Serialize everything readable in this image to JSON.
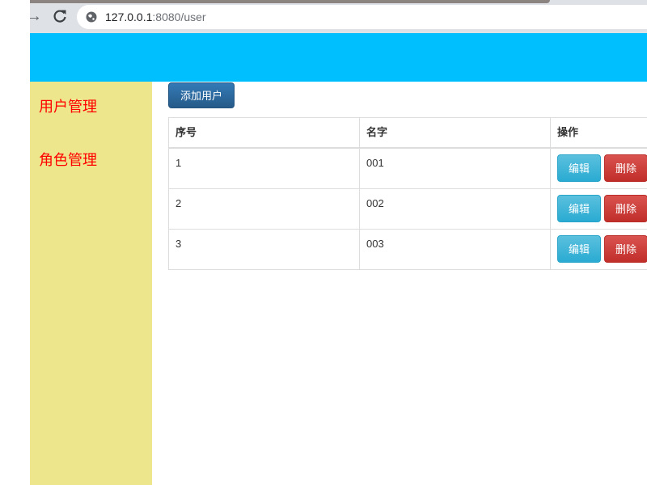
{
  "browser": {
    "url_host": "127.0.0.1",
    "url_rest": ":8080/user",
    "icons": {
      "forward": "arrow-forward-icon",
      "reload": "reload-icon",
      "site_info": "globe-icon"
    }
  },
  "colors": {
    "header": "#00bfff",
    "sidebar": "#eee68c",
    "sidebar_text": "#ff0000",
    "add_button": "#2d6ca2",
    "edit_button": "#46b8da",
    "delete_button": "#d2322d"
  },
  "sidebar": {
    "items": [
      {
        "label": "用户管理"
      },
      {
        "label": "角色管理"
      }
    ]
  },
  "toolbar": {
    "add_label": "添加用户"
  },
  "table": {
    "headers": [
      "序号",
      "名字",
      "操作"
    ],
    "rows": [
      {
        "id": "1",
        "name": "001",
        "edit": "编辑",
        "delete": "删除"
      },
      {
        "id": "2",
        "name": "002",
        "edit": "编辑",
        "delete": "删除"
      },
      {
        "id": "3",
        "name": "003",
        "edit": "编辑",
        "delete": "删除"
      }
    ]
  }
}
